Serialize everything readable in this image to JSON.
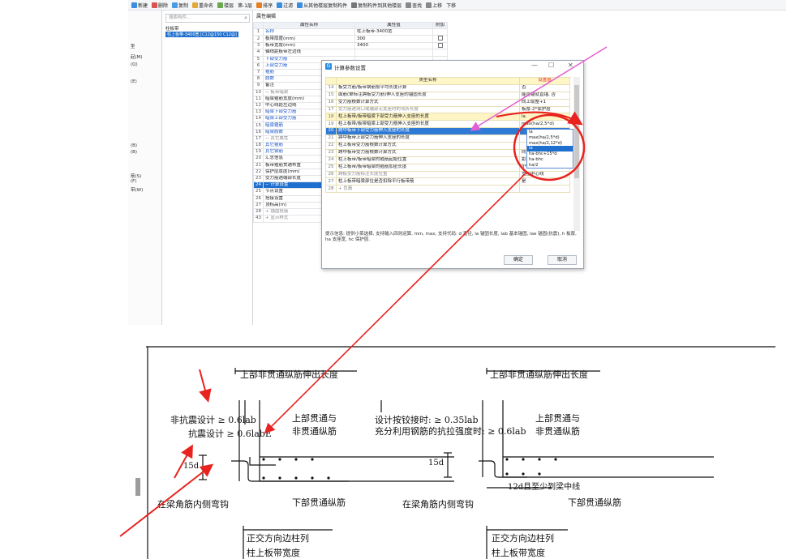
{
  "toolbar": {
    "items": [
      "新建",
      "删除",
      "复制",
      "重命名",
      "楼层",
      "第-1层",
      "排序",
      "过滤",
      "从其他楼层复制构件",
      "复制构件到其他楼层",
      "查找",
      "上移",
      "下移"
    ],
    "icon_names": [
      "new-icon",
      "delete-icon",
      "copy-icon",
      "rename-icon",
      "floor-icon",
      "sort-icon",
      "filter-icon",
      "copy-from-floor-icon",
      "copy-to-floor-icon",
      "search-icon",
      "up-icon",
      "down-icon"
    ]
  },
  "left_panel": {
    "items": [
      "型",
      "起(M)",
      "(Q)",
      "(E)",
      "(B)",
      "(B)",
      "筋(S)",
      "(F)",
      "带(W)"
    ]
  },
  "tree": {
    "search_placeholder": "搜索构件...",
    "root": "柱板带",
    "selected": "柱上板带-3400宽 [C12@150 C12@]"
  },
  "props": {
    "title": "属性编辑",
    "headers": [
      "属性名称",
      "属性值",
      "附加"
    ],
    "rows": [
      {
        "n": "1",
        "name": "名称",
        "val": "柱上板带-3400宽",
        "cb": false,
        "cls": "blue"
      },
      {
        "n": "2",
        "name": "板带厚度(mm)",
        "val": "300",
        "cb": true,
        "cls": ""
      },
      {
        "n": "3",
        "name": "板带宽度(mm)",
        "val": "3400",
        "cb": true,
        "cls": ""
      },
      {
        "n": "4",
        "name": "轴线距板带左边线",
        "val": "",
        "cb": false,
        "cls": ""
      },
      {
        "n": "5",
        "name": "下部受力筋",
        "val": "",
        "cb": false,
        "cls": "blue"
      },
      {
        "n": "6",
        "name": "上部受力筋",
        "val": "",
        "cb": false,
        "cls": "blue"
      },
      {
        "n": "7",
        "name": "箍筋",
        "val": "",
        "cb": false,
        "cls": "blue"
      },
      {
        "n": "8",
        "name": "肢数",
        "val": "",
        "cb": false,
        "cls": "blue"
      },
      {
        "n": "9",
        "name": "备注",
        "val": "",
        "cb": false,
        "cls": ""
      },
      {
        "n": "10",
        "name": "− 板带暗梁",
        "val": "",
        "cb": false,
        "cls": "grey"
      },
      {
        "n": "11",
        "name": "暗梁箍筋宽度(mm)",
        "val": "",
        "cb": false,
        "cls": ""
      },
      {
        "n": "12",
        "name": "中心线距左边线",
        "val": "",
        "cb": false,
        "cls": ""
      },
      {
        "n": "13",
        "name": "暗梁下部受力筋",
        "val": "",
        "cb": false,
        "cls": "blue"
      },
      {
        "n": "14",
        "name": "暗梁上部受力筋",
        "val": "",
        "cb": false,
        "cls": "blue"
      },
      {
        "n": "15",
        "name": "暗梁箍筋",
        "val": "",
        "cb": false,
        "cls": "blue"
      },
      {
        "n": "16",
        "name": "暗梁肢数",
        "val": "",
        "cb": false,
        "cls": "blue"
      },
      {
        "n": "17",
        "name": "− 其它属性",
        "val": "",
        "cb": false,
        "cls": "grey"
      },
      {
        "n": "18",
        "name": "其它箍筋",
        "val": "",
        "cb": false,
        "cls": "blue"
      },
      {
        "n": "19",
        "name": "其它钢筋",
        "val": "",
        "cb": false,
        "cls": "blue"
      },
      {
        "n": "20",
        "name": "汇总信息",
        "val": "",
        "cb": false,
        "cls": ""
      },
      {
        "n": "21",
        "name": "板带箍筋贯通布置",
        "val": "",
        "cb": false,
        "cls": ""
      },
      {
        "n": "22",
        "name": "保护层厚度(mm)",
        "val": "",
        "cb": false,
        "cls": ""
      },
      {
        "n": "23",
        "name": "受力筋遇端部长度",
        "val": "",
        "cb": false,
        "cls": ""
      },
      {
        "n": "24",
        "name": "− 计算设置",
        "val": "",
        "cb": false,
        "cls": "",
        "sel": true
      },
      {
        "n": "25",
        "name": "节点设置",
        "val": "",
        "cb": false,
        "cls": ""
      },
      {
        "n": "26",
        "name": "搭接设置",
        "val": "",
        "cb": false,
        "cls": ""
      },
      {
        "n": "27",
        "name": "顶标高(m)",
        "val": "层顶标高",
        "cb": true,
        "cls": ""
      },
      {
        "n": "28",
        "name": "+ 锚固搭接",
        "val": "",
        "cb": false,
        "cls": "grey"
      },
      {
        "n": "43",
        "name": "+ 显示样式",
        "val": "",
        "cb": false,
        "cls": "grey"
      }
    ]
  },
  "dialog": {
    "title": "计算参数设置",
    "headers": [
      "类型名称",
      "设置值"
    ],
    "rows": [
      {
        "n": "14",
        "name": "板受力筋/板带钢筋按平均长度计算",
        "val": "否",
        "cls": ""
      },
      {
        "n": "15",
        "name": "面筋(单标注跨板受力筋)伸入支座的锚固长度",
        "val": "能直锚就直锚, 否",
        "cls": ""
      },
      {
        "n": "16",
        "name": "受力筋根数计算方式",
        "val": "向上取整+1",
        "cls": ""
      },
      {
        "n": "17",
        "name": "受力筋遇洞口或端部无支座时的弯折长度",
        "val": "板厚-2*保护层",
        "cls": "grey"
      },
      {
        "n": "18",
        "name": "柱上板带/板带暗梁下部受力筋伸入支座的长度",
        "val": "la",
        "cls": "",
        "hl": true
      },
      {
        "n": "19",
        "name": "柱上板带/板带暗梁上部受力筋伸入支座的长度",
        "val": "max(ha/2,5*d)",
        "cls": ""
      },
      {
        "n": "20",
        "name": "跨中板带下部受力筋伸入支座的长度",
        "val": "",
        "cls": "",
        "sel": true
      },
      {
        "n": "21",
        "name": "跨中板带上部受力筋伸入支座的长度",
        "val": "",
        "cls": ""
      },
      {
        "n": "22",
        "name": "柱上板带受力筋根数计算方式",
        "val": "",
        "cls": ""
      },
      {
        "n": "23",
        "name": "跨中板带受力筋根数计算方式",
        "val": "向上取整+1",
        "cls": ""
      },
      {
        "n": "24",
        "name": "柱上板带/板带暗梁的箍筋起始位置",
        "val": "距柱边50mm",
        "cls": ""
      },
      {
        "n": "25",
        "name": "柱上板带/板带暗梁的箍筋加密长度",
        "val": "3*h",
        "cls": ""
      },
      {
        "n": "26",
        "name": "跨板受力筋标注长度位置",
        "val": "支座中心线",
        "cls": "grey"
      },
      {
        "n": "27",
        "name": "柱上板带暗梁部位是否扣除平行板带筋",
        "val": "是",
        "cls": ""
      },
      {
        "n": "28",
        "name": "+ 负筋",
        "val": "",
        "cls": "grey"
      }
    ],
    "hint": "提示信息: 提供小菜选择, 支持输入四则运算, min, max, 支持代码: d 直径, la 锚固长度, lab 基本锚固, lae 锚固(抗震), h 板厚, ha 支座宽, hc 保护层.",
    "ok": "确定",
    "cancel": "取消"
  },
  "dropdown": {
    "options": [
      "la",
      "max(ha/2,5*d)",
      "max(ha/2,12*d)",
      "la",
      "ha-bhc+15*d",
      "ha-bhc",
      "ha/2"
    ],
    "selected_index": 3
  },
  "drawing": {
    "left": {
      "top_dim": "上部非贯通纵筋伸出长度",
      "nonseismic": "非抗震设计 ≥ 0.6lab",
      "seismic": "抗震设计 ≥ 0.6labE",
      "top_through": "上部贯通与",
      "top_through2": "非贯通纵筋",
      "hook15": "15d",
      "corner": "在梁角筋内侧弯钩",
      "bottom_through": "下部贯通纵筋",
      "col_dir": "正交方向边柱列",
      "width": "柱上板带宽度"
    },
    "right": {
      "top_dim": "上部非贯通纵筋伸出长度",
      "hinge": "设计按铰接时: ≥ 0.35lab",
      "full": "充分利用钢筋的抗拉强度时: ≥ 0.6lab",
      "top_through": "上部贯通与",
      "top_through2": "非贯通纵筋",
      "hook15": "15d",
      "corner": "在梁角筋内侧弯钩",
      "mid": "12d且至少到梁中线",
      "bottom_through": "下部贯通纵筋",
      "col_dir": "正交方向边柱列",
      "width": "柱上板带宽度"
    }
  },
  "colors": {
    "annotation_red": "#e8231f",
    "annotation_magenta": "#e25fd2",
    "selection_blue": "#1f6fce"
  }
}
